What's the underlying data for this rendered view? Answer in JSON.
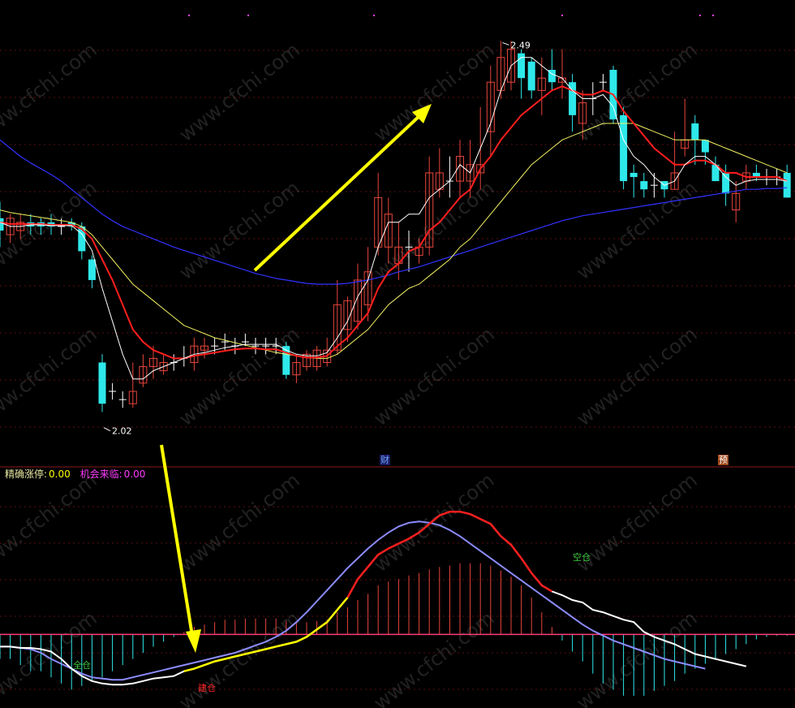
{
  "indicator_header": {
    "label1": "精确涨停:",
    "value1": "0.00",
    "label2": "机会来临:",
    "value2": "0.00"
  },
  "event_badges": [
    "财",
    "预"
  ],
  "watermark": "www.cfchi.com",
  "annotations": {
    "high_label": "2.49",
    "low_label": "2.02"
  },
  "macd_markers": {
    "left_buy": "全仓",
    "bottom_buy": "建仓",
    "top_sell": "空仓"
  },
  "colors": {
    "background": "#000000",
    "candle_up": "#e8453c",
    "candle_down": "#2ee8ea",
    "candle_flat": "#ffffff",
    "ma_white": "#ffffff",
    "ma_red": "#ff1e1e",
    "ma_yellow": "#f0f060",
    "ma_blue": "#3232ff",
    "arrow": "#ffff00",
    "macd_zero_line": "#ff3c78",
    "macd_hist_up": "#e8453c",
    "macd_hist_down": "#2ee8ea",
    "macd_dif": "#ffffff",
    "macd_dea": "#8c8cff",
    "macd_highlight_up": "#ff1e1e",
    "macd_highlight_low": "#ffff00",
    "header_label1": "#e6e6a0",
    "header_value1": "#ffff00",
    "header_label2": "#ff3cff",
    "header_value2": "#ff3cff"
  },
  "chart_data": [
    {
      "type": "candlestick",
      "title": "",
      "price_high": 2.49,
      "price_low": 2.02,
      "ylim": [
        2.0,
        2.52
      ],
      "candles": [
        [
          2.275,
          2.26,
          2.295,
          2.24
        ],
        [
          2.255,
          2.275,
          2.28,
          2.245
        ],
        [
          2.26,
          2.27,
          2.28,
          2.25
        ],
        [
          2.27,
          2.265,
          2.28,
          2.255
        ],
        [
          2.27,
          2.265,
          2.275,
          2.255
        ],
        [
          2.27,
          2.265,
          2.28,
          2.255
        ],
        [
          2.265,
          2.265,
          2.275,
          2.255
        ],
        [
          2.27,
          2.265,
          2.275,
          2.26
        ],
        [
          2.265,
          2.235,
          2.27,
          2.225
        ],
        [
          2.225,
          2.2,
          2.23,
          2.19
        ],
        [
          2.1,
          2.05,
          2.11,
          2.04
        ],
        [
          2.065,
          2.065,
          2.075,
          2.055
        ],
        [
          2.055,
          2.055,
          2.065,
          2.045
        ],
        [
          2.05,
          2.065,
          2.1,
          2.045
        ],
        [
          2.075,
          2.095,
          2.11,
          2.07
        ],
        [
          2.095,
          2.105,
          2.12,
          2.08
        ],
        [
          2.09,
          2.1,
          2.11,
          2.085
        ],
        [
          2.1,
          2.1,
          2.11,
          2.09
        ],
        [
          2.105,
          2.105,
          2.12,
          2.095
        ],
        [
          2.1,
          2.12,
          2.13,
          2.09
        ],
        [
          2.115,
          2.12,
          2.13,
          2.105
        ],
        [
          2.12,
          2.12,
          2.13,
          2.11
        ],
        [
          2.125,
          2.125,
          2.135,
          2.115
        ],
        [
          2.12,
          2.12,
          2.13,
          2.11
        ],
        [
          2.125,
          2.125,
          2.135,
          2.12
        ],
        [
          2.12,
          2.12,
          2.13,
          2.11
        ],
        [
          2.12,
          2.12,
          2.13,
          2.11
        ],
        [
          2.12,
          2.12,
          2.13,
          2.11
        ],
        [
          2.12,
          2.085,
          2.125,
          2.08
        ],
        [
          2.085,
          2.1,
          2.11,
          2.075
        ],
        [
          2.095,
          2.11,
          2.115,
          2.09
        ],
        [
          2.095,
          2.115,
          2.12,
          2.09
        ],
        [
          2.1,
          2.115,
          2.13,
          2.095
        ],
        [
          2.115,
          2.17,
          2.2,
          2.11
        ],
        [
          2.14,
          2.175,
          2.18,
          2.125
        ],
        [
          2.15,
          2.2,
          2.22,
          2.14
        ],
        [
          2.17,
          2.21,
          2.24,
          2.15
        ],
        [
          2.24,
          2.3,
          2.33,
          2.23
        ],
        [
          2.24,
          2.28,
          2.3,
          2.22
        ],
        [
          2.22,
          2.24,
          2.27,
          2.2
        ],
        [
          2.24,
          2.24,
          2.26,
          2.21
        ],
        [
          2.23,
          2.24,
          2.25,
          2.22
        ],
        [
          2.24,
          2.33,
          2.35,
          2.23
        ],
        [
          2.31,
          2.33,
          2.36,
          2.3
        ],
        [
          2.32,
          2.32,
          2.35,
          2.3
        ],
        [
          2.32,
          2.35,
          2.37,
          2.3
        ],
        [
          2.32,
          2.34,
          2.37,
          2.3
        ],
        [
          2.33,
          2.34,
          2.41,
          2.31
        ],
        [
          2.38,
          2.44,
          2.46,
          2.35
        ],
        [
          2.43,
          2.47,
          2.49,
          2.42
        ],
        [
          2.44,
          2.48,
          2.49,
          2.43
        ],
        [
          2.475,
          2.445,
          2.48,
          2.42
        ],
        [
          2.465,
          2.43,
          2.47,
          2.42
        ],
        [
          2.43,
          2.445,
          2.47,
          2.4
        ],
        [
          2.455,
          2.44,
          2.48,
          2.43
        ],
        [
          2.44,
          2.445,
          2.48,
          2.42
        ],
        [
          2.44,
          2.4,
          2.45,
          2.38
        ],
        [
          2.39,
          2.415,
          2.43,
          2.37
        ],
        [
          2.42,
          2.42,
          2.44,
          2.4
        ],
        [
          2.44,
          2.44,
          2.45,
          2.43
        ],
        [
          2.455,
          2.395,
          2.46,
          2.39
        ],
        [
          2.4,
          2.32,
          2.41,
          2.31
        ],
        [
          2.33,
          2.325,
          2.34,
          2.3
        ],
        [
          2.32,
          2.31,
          2.33,
          2.3
        ],
        [
          2.315,
          2.315,
          2.33,
          2.3
        ],
        [
          2.32,
          2.31,
          2.32,
          2.3
        ],
        [
          2.31,
          2.33,
          2.38,
          2.31
        ],
        [
          2.36,
          2.37,
          2.42,
          2.35
        ],
        [
          2.39,
          2.37,
          2.4,
          2.34
        ],
        [
          2.37,
          2.355,
          2.37,
          2.34
        ],
        [
          2.34,
          2.32,
          2.35,
          2.32
        ],
        [
          2.33,
          2.305,
          2.34,
          2.29
        ],
        [
          2.285,
          2.305,
          2.32,
          2.27
        ],
        [
          2.32,
          2.33,
          2.34,
          2.31
        ],
        [
          2.33,
          2.325,
          2.34,
          2.32
        ],
        [
          2.325,
          2.325,
          2.335,
          2.315
        ],
        [
          2.325,
          2.325,
          2.335,
          2.315
        ],
        [
          2.33,
          2.3,
          2.34,
          2.3
        ]
      ],
      "ma_white": [
        2.27,
        2.265,
        2.265,
        2.267,
        2.267,
        2.266,
        2.266,
        2.266,
        2.256,
        2.236,
        2.19,
        2.15,
        2.11,
        2.08,
        2.08,
        2.09,
        2.095,
        2.1,
        2.105,
        2.11,
        2.112,
        2.115,
        2.118,
        2.12,
        2.122,
        2.122,
        2.122,
        2.122,
        2.115,
        2.11,
        2.108,
        2.108,
        2.112,
        2.13,
        2.15,
        2.18,
        2.2,
        2.24,
        2.27,
        2.27,
        2.28,
        2.28,
        2.3,
        2.31,
        2.32,
        2.34,
        2.33,
        2.36,
        2.39,
        2.43,
        2.46,
        2.47,
        2.47,
        2.46,
        2.45,
        2.445,
        2.43,
        2.42,
        2.42,
        2.425,
        2.41,
        2.37,
        2.35,
        2.34,
        2.325,
        2.315,
        2.32,
        2.34,
        2.35,
        2.35,
        2.34,
        2.325,
        2.315,
        2.32,
        2.322,
        2.322,
        2.322,
        2.32
      ],
      "ma_red": [
        2.27,
        2.268,
        2.268,
        2.268,
        2.268,
        2.267,
        2.267,
        2.267,
        2.262,
        2.25,
        2.225,
        2.2,
        2.17,
        2.14,
        2.125,
        2.115,
        2.11,
        2.105,
        2.105,
        2.108,
        2.11,
        2.112,
        2.114,
        2.116,
        2.117,
        2.117,
        2.116,
        2.116,
        2.112,
        2.108,
        2.106,
        2.106,
        2.108,
        2.12,
        2.13,
        2.145,
        2.16,
        2.19,
        2.21,
        2.22,
        2.235,
        2.24,
        2.26,
        2.27,
        2.285,
        2.3,
        2.31,
        2.335,
        2.35,
        2.37,
        2.385,
        2.4,
        2.41,
        2.42,
        2.43,
        2.435,
        2.43,
        2.425,
        2.425,
        2.43,
        2.425,
        2.405,
        2.39,
        2.375,
        2.36,
        2.35,
        2.34,
        2.34,
        2.345,
        2.345,
        2.34,
        2.33,
        2.33,
        2.325,
        2.325,
        2.325,
        2.325,
        2.32
      ],
      "ma_yellow": [
        2.285,
        2.282,
        2.28,
        2.278,
        2.276,
        2.274,
        2.272,
        2.27,
        2.265,
        2.255,
        2.24,
        2.225,
        2.21,
        2.195,
        2.185,
        2.175,
        2.165,
        2.155,
        2.145,
        2.14,
        2.135,
        2.13,
        2.127,
        2.124,
        2.121,
        2.118,
        2.115,
        2.112,
        2.11,
        2.108,
        2.106,
        2.105,
        2.105,
        2.11,
        2.12,
        2.13,
        2.14,
        2.155,
        2.17,
        2.18,
        2.19,
        2.195,
        2.205,
        2.215,
        2.225,
        2.24,
        2.25,
        2.265,
        2.28,
        2.295,
        2.31,
        2.325,
        2.34,
        2.35,
        2.36,
        2.37,
        2.375,
        2.38,
        2.385,
        2.39,
        2.39,
        2.39,
        2.39,
        2.385,
        2.38,
        2.375,
        2.37,
        2.37,
        2.37,
        2.37,
        2.365,
        2.36,
        2.355,
        2.35,
        2.345,
        2.34,
        2.335,
        2.33
      ],
      "ma_blue": [
        2.37,
        2.36,
        2.35,
        2.342,
        2.335,
        2.328,
        2.32,
        2.31,
        2.3,
        2.29,
        2.28,
        2.272,
        2.265,
        2.26,
        2.255,
        2.25,
        2.245,
        2.24,
        2.236,
        2.232,
        2.228,
        2.224,
        2.22,
        2.216,
        2.212,
        2.208,
        2.205,
        2.202,
        2.2,
        2.198,
        2.196,
        2.195,
        2.195,
        2.195,
        2.196,
        2.198,
        2.2,
        2.203,
        2.206,
        2.21,
        2.213,
        2.216,
        2.22,
        2.224,
        2.228,
        2.232,
        2.236,
        2.24,
        2.244,
        2.248,
        2.252,
        2.256,
        2.26,
        2.264,
        2.268,
        2.272,
        2.275,
        2.278,
        2.28,
        2.282,
        2.284,
        2.286,
        2.288,
        2.29,
        2.292,
        2.294,
        2.296,
        2.298,
        2.3,
        2.302,
        2.304,
        2.306,
        2.308,
        2.31,
        2.31,
        2.311,
        2.311,
        2.312
      ]
    },
    {
      "type": "macd",
      "ylim": [
        -0.06,
        0.12
      ],
      "zero_line": 0.0,
      "histogram": [
        -0.02,
        -0.02,
        -0.025,
        -0.03,
        -0.03,
        -0.035,
        -0.04,
        -0.045,
        -0.042,
        -0.038,
        -0.035,
        -0.03,
        -0.025,
        -0.02,
        -0.015,
        -0.01,
        -0.006,
        -0.002,
        0.002,
        0.006,
        0.008,
        0.01,
        0.012,
        0.012,
        0.013,
        0.013,
        0.013,
        0.013,
        0.011,
        0.01,
        0.01,
        0.011,
        0.012,
        0.018,
        0.022,
        0.028,
        0.033,
        0.04,
        0.043,
        0.045,
        0.048,
        0.05,
        0.053,
        0.055,
        0.056,
        0.058,
        0.058,
        0.058,
        0.056,
        0.052,
        0.047,
        0.04,
        0.03,
        0.018,
        0.006,
        -0.005,
        -0.014,
        -0.022,
        -0.032,
        -0.04,
        -0.045,
        -0.05,
        -0.05,
        -0.05,
        -0.046,
        -0.042,
        -0.038,
        -0.032,
        -0.028,
        -0.024,
        -0.02,
        -0.016,
        -0.012,
        -0.008,
        -0.004,
        -0.002,
        -0.001,
        -0.001
      ],
      "dif": [
        -0.01,
        -0.01,
        -0.011,
        -0.011,
        -0.012,
        -0.014,
        -0.02,
        -0.028,
        -0.034,
        -0.038,
        -0.04,
        -0.041,
        -0.041,
        -0.04,
        -0.038,
        -0.036,
        -0.035,
        -0.034,
        -0.03,
        -0.028,
        -0.025,
        -0.022,
        -0.02,
        -0.018,
        -0.016,
        -0.014,
        -0.012,
        -0.01,
        -0.008,
        -0.006,
        -0.002,
        0.004,
        0.01,
        0.02,
        0.03,
        0.045,
        0.055,
        0.065,
        0.07,
        0.074,
        0.078,
        0.083,
        0.09,
        0.097,
        0.1,
        0.1,
        0.098,
        0.094,
        0.09,
        0.08,
        0.073,
        0.062,
        0.05,
        0.04,
        0.035,
        0.032,
        0.028,
        0.026,
        0.02,
        0.018,
        0.015,
        0.012,
        0.01,
        0.002,
        -0.002,
        -0.005,
        -0.008,
        -0.012,
        -0.016,
        -0.018,
        -0.02,
        -0.022,
        -0.024,
        -0.026
      ],
      "dea": [
        -0.01,
        -0.01,
        -0.011,
        -0.012,
        -0.015,
        -0.02,
        -0.024,
        -0.028,
        -0.032,
        -0.035,
        -0.036,
        -0.037,
        -0.037,
        -0.035,
        -0.033,
        -0.031,
        -0.029,
        -0.027,
        -0.025,
        -0.023,
        -0.021,
        -0.019,
        -0.017,
        -0.015,
        -0.012,
        -0.009,
        -0.006,
        -0.002,
        0.003,
        0.01,
        0.018,
        0.027,
        0.036,
        0.045,
        0.054,
        0.062,
        0.07,
        0.077,
        0.083,
        0.088,
        0.091,
        0.092,
        0.091,
        0.089,
        0.085,
        0.08,
        0.074,
        0.068,
        0.062,
        0.056,
        0.05,
        0.044,
        0.038,
        0.032,
        0.026,
        0.02,
        0.014,
        0.008,
        0.003,
        -0.001,
        -0.005,
        -0.008,
        -0.011,
        -0.014,
        -0.017,
        -0.02,
        -0.022,
        -0.024,
        -0.026,
        -0.028
      ]
    }
  ]
}
